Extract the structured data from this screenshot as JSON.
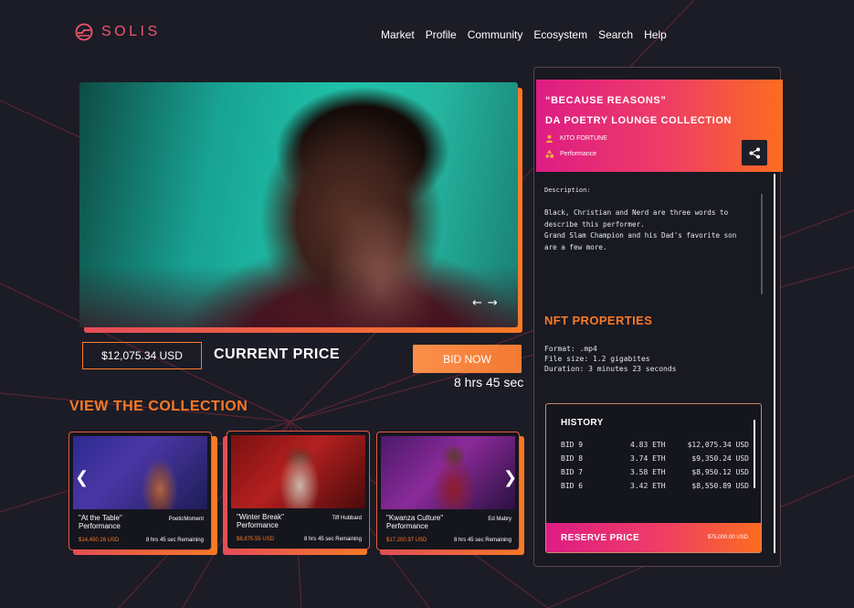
{
  "brand": {
    "name": "SOLIS",
    "accent": "#f0566d"
  },
  "nav": {
    "items": [
      "Market",
      "Profile",
      "Community",
      "Ecosystem",
      "Search",
      "Help"
    ]
  },
  "hero": {
    "price": "$12,075.34 USD",
    "price_label": "CURRENT PRICE",
    "bid_button": "BID NOW",
    "time_left": "8 hrs 45 sec",
    "prev_icon": "arrow-left-icon",
    "next_icon": "arrow-right-icon"
  },
  "collection": {
    "heading": "VIEW THE COLLECTION",
    "cards": [
      {
        "title": "\"At the Table\" Performance",
        "author": "PoeticMoment",
        "price": "$14,450.26 USD",
        "remaining": "8 hrs 45 sec Remaining"
      },
      {
        "title": "\"Winter Break\" Performance",
        "author": "Tiff Hubbard",
        "price": "$8,875.55 USD",
        "remaining": "8 hrs 45 sec Remaining"
      },
      {
        "title": "\"Kwanza Culture\" Performance",
        "author": "Ed Mabry",
        "price": "$17,200.97 USD",
        "remaining": "8 hrs 45 sec Remaining"
      }
    ]
  },
  "details": {
    "quote": "“BECAUSE REASONS”",
    "collection_name": "DA POETRY LOUNGE COLLECTION",
    "artist": "KITO FORTUNE",
    "category": "Performance",
    "share_icon": "share-icon",
    "description_label": "Description:",
    "description_lines": [
      "Black, Christian and Nerd are three words to",
      "describe this performer.",
      "Grand Slam Champion and his Dad's favorite son",
      "are a few more."
    ],
    "properties_heading": "NFT PROPERTIES",
    "properties": [
      "Format: .mp4",
      "File size: 1.2 gigabites",
      "Duration: 3 minutes 23 seconds"
    ]
  },
  "history": {
    "title": "HISTORY",
    "bids": [
      {
        "bid": "BID 9",
        "eth": "4.83 ETH",
        "usd": "$12,075.34 USD"
      },
      {
        "bid": "BID 8",
        "eth": "3.74 ETH",
        "usd": "$9,350.24 USD"
      },
      {
        "bid": "BID 7",
        "eth": "3.58 ETH",
        "usd": "$8,950.12 USD"
      },
      {
        "bid": "BID 6",
        "eth": "3.42 ETH",
        "usd": "$8,550.89 USD"
      }
    ],
    "reserve_label": "RESERVE PRICE",
    "reserve_value": "$75,000.00 USD"
  },
  "colors": {
    "background": "#1c1c26",
    "orange": "#fb7a25",
    "magenta": "#de1c85"
  }
}
